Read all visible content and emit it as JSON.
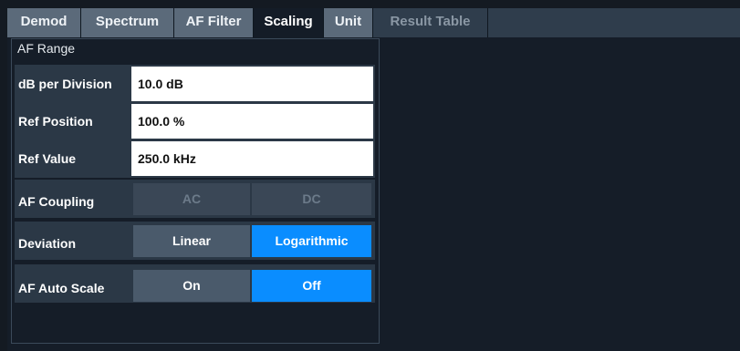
{
  "tabs": [
    {
      "label": "Demod",
      "state": "normal"
    },
    {
      "label": "Spectrum",
      "state": "normal"
    },
    {
      "label": "AF Filter",
      "state": "normal"
    },
    {
      "label": "Scaling",
      "state": "active"
    },
    {
      "label": "Unit",
      "state": "normal"
    },
    {
      "label": "Result Table",
      "state": "disabled"
    }
  ],
  "group_title": "AF Range",
  "fields": {
    "db_per_division": {
      "label": "dB per Division",
      "value": "10.0 dB"
    },
    "ref_position": {
      "label": "Ref Position",
      "value": "100.0 %"
    },
    "ref_value": {
      "label": "Ref Value",
      "value": "250.0 kHz"
    }
  },
  "af_coupling": {
    "label": "AF Coupling",
    "options": [
      "AC",
      "DC"
    ],
    "enabled": false
  },
  "deviation": {
    "label": "Deviation",
    "options": [
      "Linear",
      "Logarithmic"
    ],
    "selected": "Logarithmic"
  },
  "af_auto_scale": {
    "label": "AF Auto Scale",
    "options": [
      "On",
      "Off"
    ],
    "selected": "Off"
  },
  "colors": {
    "accent": "#0a8dff",
    "background": "#151d28",
    "tab_inactive": "#5b6a7a",
    "panel": "#2b3846"
  }
}
